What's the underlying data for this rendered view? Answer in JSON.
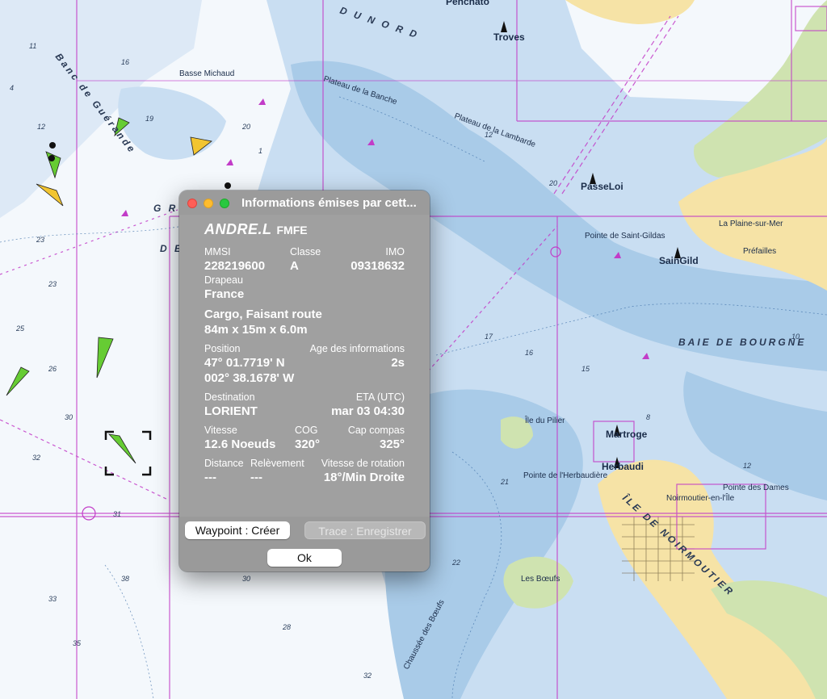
{
  "dialog": {
    "title": "Informations émises par cett...",
    "ship_name": "ANDRE.L",
    "callsign": "FMFE",
    "labels": {
      "mmsi": "MMSI",
      "classe": "Classe",
      "imo": "IMO",
      "drapeau": "Drapeau",
      "position": "Position",
      "age": "Age des informations",
      "destination": "Destination",
      "eta": "ETA (UTC)",
      "vitesse": "Vitesse",
      "cog": "COG",
      "cap": "Cap compas",
      "distance": "Distance",
      "relevement": "Relèvement",
      "rotation": "Vitesse de rotation"
    },
    "values": {
      "mmsi": "228219600",
      "classe": "A",
      "imo": "09318632",
      "drapeau": "France",
      "type_status": "Cargo, Faisant route",
      "dimensions": "84m x 15m x 6.0m",
      "lat": "47° 01.7719' N",
      "lon": "002° 38.1678' W",
      "age": "2s",
      "destination": "LORIENT",
      "eta": "mar 03 04:30",
      "vitesse": "12.6 Noeuds",
      "cog": "320°",
      "cap": "325°",
      "distance": "---",
      "relevement": "---",
      "rotation": "18°/Min Droite"
    },
    "buttons": {
      "waypoint": "Waypoint : Créer",
      "trace": "Trace : Enregistrer",
      "ok": "Ok"
    }
  },
  "map_labels": {
    "trove": "Troves",
    "passeloi": "PasseLoi",
    "saingild": "SainGild",
    "martroge": "Martroge",
    "herbaudi": "Herbaudi",
    "penchato": "Penchato",
    "banc_guerande": "Banc de Guérande",
    "plateau_banche": "Plateau de la Banche",
    "plateau_lambarde": "Plateau de la Lambarde",
    "baie_bourgneuf": "BAIE DE BOURGNE",
    "ile_noirmoutier": "ÎLE DE NOIRMOUTIER",
    "chaussee_boeufs": "Chaussée des Bœufs",
    "pointe_gildas": "Pointe de Saint-Gildas",
    "plaine_sur_mer": "La Plaine-sur-Mer",
    "prefailles": "Préfailles",
    "noirmoutier_ville": "Noirmoutier-en-l'Île",
    "pointe_herbaudiere": "Pointe de l'Herbaudière",
    "pointe_dames": "Pointe des Dames",
    "les_boeufs": "Les Bœufs",
    "du_nord": "D U   N O R D",
    "basse_michaud": "Basse Michaud",
    "ile_pilier": "Île du Pilier",
    "gr": "G R",
    "de": "D E"
  },
  "colors": {
    "land": "#f6e3a6",
    "shallow": "#a9cbe8",
    "mid": "#c9def2",
    "deep": "#f4f8fc",
    "magenta": "#c23cc8",
    "green_land": "#cfe3b0",
    "vessel_green": "#66cc33",
    "vessel_yellow": "#f2c531"
  }
}
